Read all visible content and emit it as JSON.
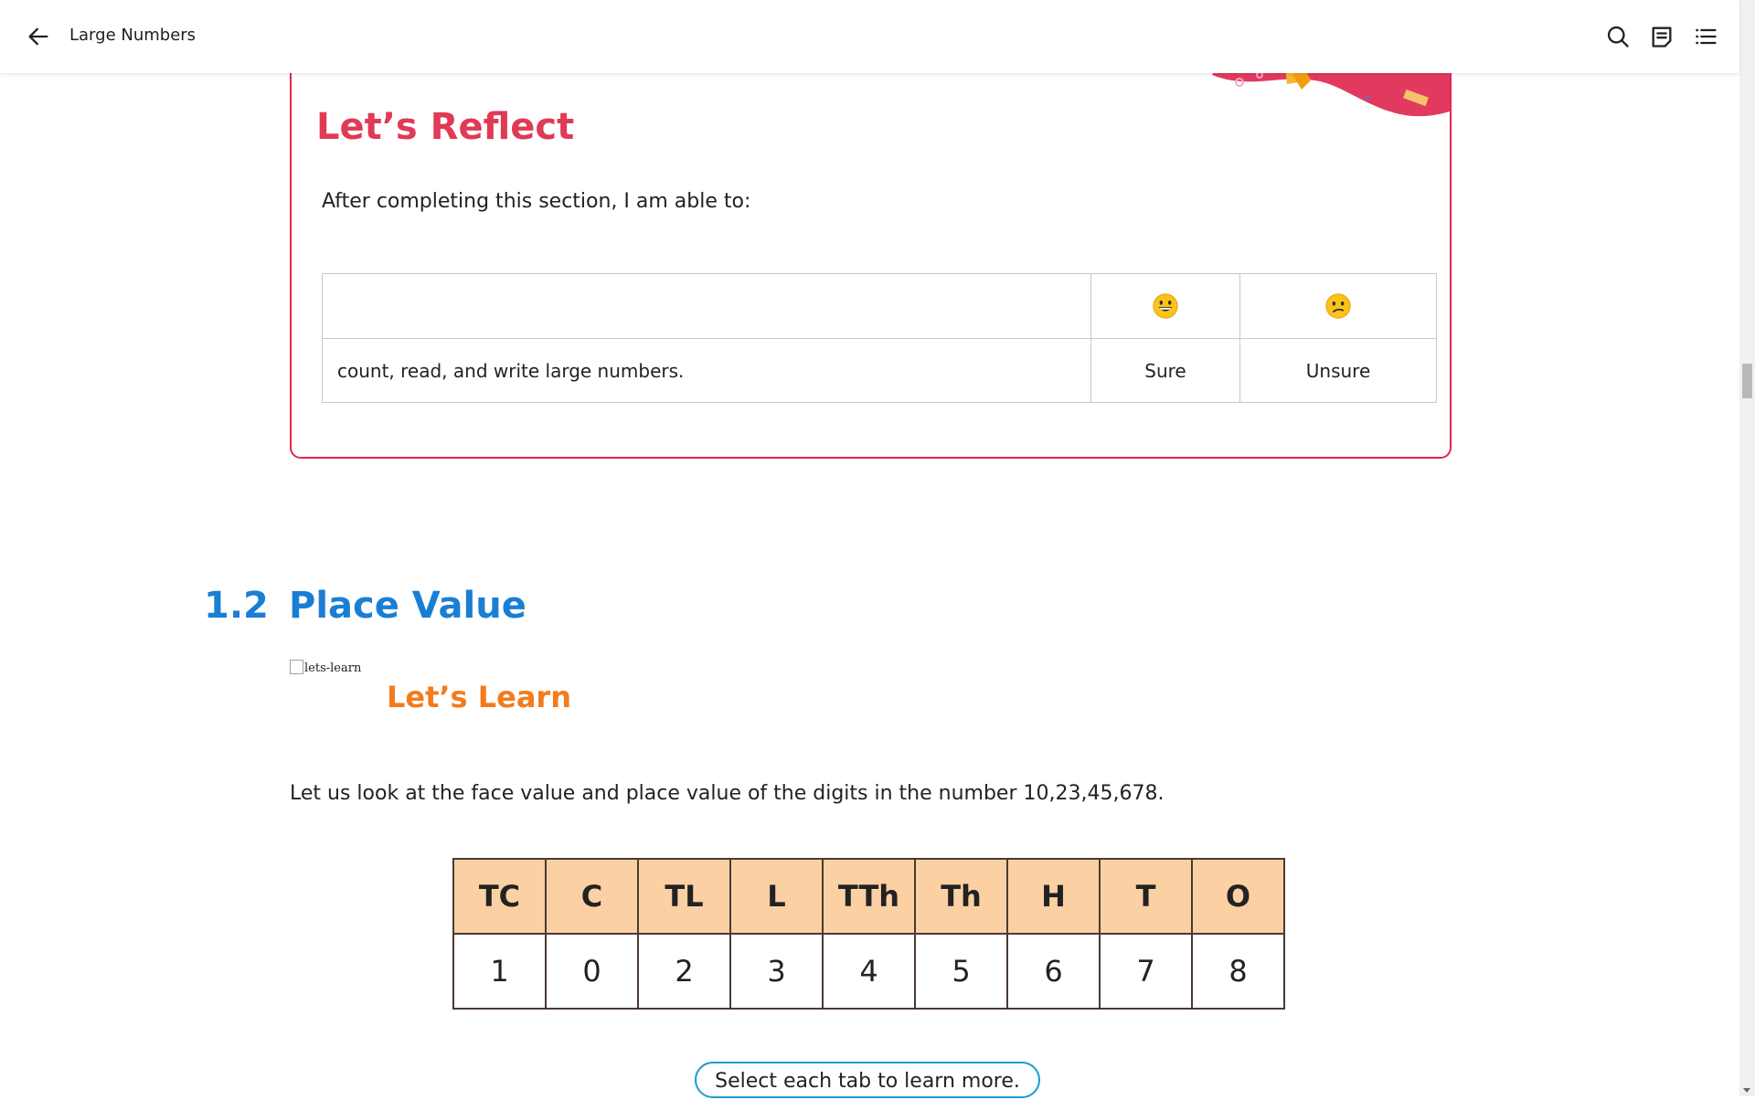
{
  "header": {
    "title": "Large Numbers",
    "icons": [
      "back-arrow-icon",
      "search-icon",
      "notes-icon",
      "table-of-contents-icon"
    ]
  },
  "reflect": {
    "title": "Let’s Reflect",
    "intro": "After completing this section, I am able to:",
    "table": {
      "header_emojis": [
        "grinning-face-emoji",
        "confused-face-emoji"
      ],
      "rows": [
        {
          "statement": "count, read, and write large numbers.",
          "sure": "Sure",
          "unsure": "Unsure"
        }
      ]
    },
    "accent_color": "#e0264d"
  },
  "section": {
    "number": "1.2",
    "title": "Place Value",
    "accent_color": "#1a7fd4"
  },
  "learn": {
    "image_alt": "lets-learn",
    "title": "Let’s Learn",
    "intro": "Let us look at the face value and place value of the digits in the number 10,23,45,678.",
    "accent_color": "#f27c1c"
  },
  "place_value_table": {
    "headers": [
      "TC",
      "C",
      "TL",
      "L",
      "TTh",
      "Th",
      "H",
      "T",
      "O"
    ],
    "digits": [
      "1",
      "0",
      "2",
      "3",
      "4",
      "5",
      "6",
      "7",
      "8"
    ],
    "header_bg": "#fbd0a3"
  },
  "tab_hint": "Select each tab to learn more."
}
